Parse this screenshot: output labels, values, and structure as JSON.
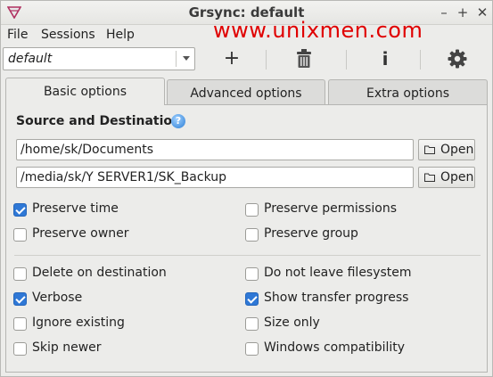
{
  "window": {
    "title": "Grsync: default"
  },
  "menu": {
    "file": "File",
    "sessions": "Sessions",
    "help": "Help"
  },
  "watermark": "www.unixmen.com",
  "toolbar": {
    "session": "default",
    "add_icon": "+",
    "info_icon": "i"
  },
  "tabs": [
    "Basic options",
    "Advanced options",
    "Extra options"
  ],
  "basic": {
    "section_title": "Source and Destination:",
    "source": "/home/sk/Documents",
    "destination": "/media/sk/Y SERVER1/SK_Backup",
    "open_label": "Open",
    "options": [
      {
        "label": "Preserve time",
        "checked": true
      },
      {
        "label": "Preserve permissions",
        "checked": false
      },
      {
        "label": "Preserve owner",
        "checked": false
      },
      {
        "label": "Preserve group",
        "checked": false
      },
      {
        "label": "Delete on destination",
        "checked": false
      },
      {
        "label": "Do not leave filesystem",
        "checked": false
      },
      {
        "label": "Verbose",
        "checked": true
      },
      {
        "label": "Show transfer progress",
        "checked": true
      },
      {
        "label": "Ignore existing",
        "checked": false
      },
      {
        "label": "Size only",
        "checked": false
      },
      {
        "label": "Skip newer",
        "checked": false
      },
      {
        "label": "Windows compatibility",
        "checked": false
      }
    ]
  }
}
